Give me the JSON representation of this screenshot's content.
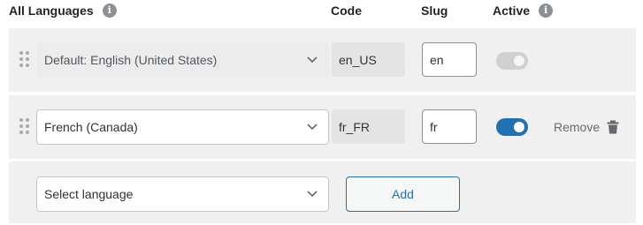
{
  "header": {
    "languages_label": "All Languages",
    "code_label": "Code",
    "slug_label": "Slug",
    "active_label": "Active",
    "info_glyph": "i"
  },
  "rows": [
    {
      "language": "Default: English (United States)",
      "code": "en_US",
      "slug": "en",
      "active": true,
      "toggle_disabled": true
    },
    {
      "language": "French (Canada)",
      "code": "fr_FR",
      "slug": "fr",
      "active": true,
      "toggle_disabled": false,
      "remove_label": "Remove"
    }
  ],
  "new_row": {
    "select_placeholder": "Select language",
    "add_label": "Add"
  },
  "colors": {
    "accent": "#2271b1",
    "row_bg": "#f0f0f1",
    "muted": "#646970"
  },
  "icons": [
    "info-icon",
    "drag-handle-icon",
    "chevron-down-icon",
    "trash-icon"
  ]
}
